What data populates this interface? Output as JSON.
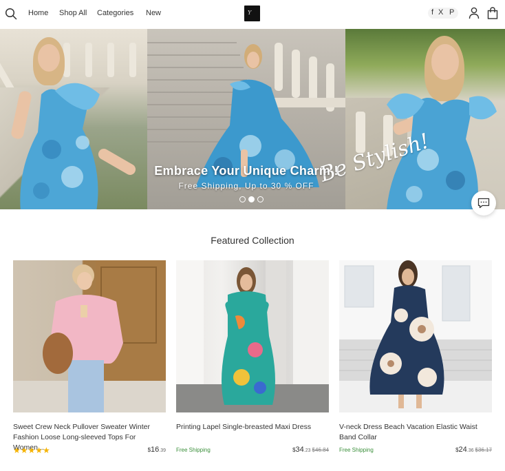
{
  "header": {
    "nav": [
      "Home",
      "Shop All",
      "Categories",
      "New"
    ],
    "logo_mark": "Y",
    "social": [
      "f",
      "X",
      "P"
    ]
  },
  "hero": {
    "title": "Embrace Your Unique Charm !",
    "subtitle": "Free Shipping, Up to 30 % OFF",
    "script_text": "Be Stylish!",
    "slide_count": 3,
    "active_slide": 2
  },
  "featured": {
    "title": "Featured Collection",
    "products": [
      {
        "name": "Sweet Crew Neck Pullover Sweater Winter Fashion Loose Long-sleeved Tops For Women...",
        "rating_stars": "★★★★★",
        "shipping": "",
        "price_symbol": "$",
        "price_main": "16",
        "price_cents": ".39",
        "price_old": ""
      },
      {
        "name": "Printing Lapel Single-breasted Maxi Dress",
        "rating_stars": "",
        "shipping": "Free Shipping",
        "price_symbol": "$",
        "price_main": "34",
        "price_cents": ".23",
        "price_old": "$46.84"
      },
      {
        "name": "V-neck Dress Beach Vacation Elastic Waist Band Collar",
        "rating_stars": "",
        "shipping": "Free Shipping",
        "price_symbol": "$",
        "price_main": "24",
        "price_cents": ".36",
        "price_old": "$36.17"
      }
    ]
  },
  "colors": {
    "free_shipping": "#3a8f3a",
    "stars": "#f5b301"
  }
}
